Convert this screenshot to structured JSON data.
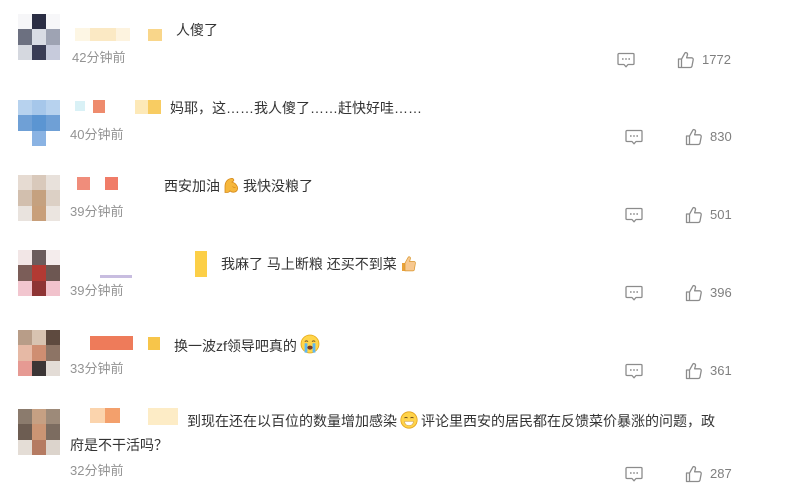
{
  "colors": {
    "background": "#ffffff",
    "text": "#333333",
    "meta_text": "#939393",
    "icon": "#8c8c8c",
    "like_count": "#7f7f7f"
  },
  "icons": {
    "reply": "comment-icon",
    "like": "like-icon"
  },
  "comments": [
    {
      "text": "人傻了",
      "time": "42分钟前",
      "likes": "1772",
      "avatar_mosaic": [
        "#f6f6f8",
        "#2b2e44",
        "#f7f7f9",
        "#6c7080",
        "#d9dce4",
        "#9ea3b3",
        "#d5d8df",
        "#3a3d55",
        "#c7cbdc"
      ]
    },
    {
      "text": "妈耶，这……我人傻了……赶快好哇……",
      "time": "40分钟前",
      "likes": "830",
      "avatar_mosaic": [
        "#b7d2ee",
        "#a6c7ea",
        "#b7d2ee",
        "#6fa0d6",
        "#5b95d2",
        "#6fa0d6",
        "#ffffff",
        "#8ab3e3",
        "#ffffff"
      ]
    },
    {
      "text": "西安加油",
      "emoji": "flexed-biceps-emoji",
      "text_after_emoji": "我快没粮了",
      "time": "39分钟前",
      "likes": "501",
      "avatar_mosaic": [
        "#e6dbd2",
        "#d9c9bb",
        "#e8e1db",
        "#d2bfae",
        "#c5a17f",
        "#dcd0c5",
        "#e9e3de",
        "#c89f7a",
        "#ebe5e0"
      ]
    },
    {
      "text": "我麻了 马上断粮 还买不到菜",
      "emoji": "thumbs-up-emoji",
      "time": "39分钟前",
      "likes": "396",
      "avatar_mosaic": [
        "#f2e6e6",
        "#6b5c5c",
        "#f4ecec",
        "#7b5d58",
        "#b23a33",
        "#6d5752",
        "#f2c6cf",
        "#8e3434",
        "#f1c2cc"
      ]
    },
    {
      "text": "换一波zf领导吧真的",
      "emoji": "crying-face-emoji",
      "time": "33分钟前",
      "likes": "361",
      "avatar_mosaic": [
        "#b89d88",
        "#d8c3b1",
        "#5e4a3f",
        "#e6b9a5",
        "#cf8e72",
        "#8d7465",
        "#e69a93",
        "#3b3535",
        "#e3dcd6"
      ]
    },
    {
      "text": "到现在还在以百位的数量增加感染",
      "emoji": "face-emoji",
      "text_after_emoji": "评论里西安的居民都在反馈菜价暴涨的问题，政",
      "text_continued": "府是不干活吗？",
      "time": "32分钟前",
      "likes": "287",
      "avatar_mosaic": [
        "#8b7b6d",
        "#c6a083",
        "#9d8a79",
        "#6d5d52",
        "#cb9574",
        "#7c6c60",
        "#e4ddd6",
        "#b57b62",
        "#dcd4cc"
      ]
    }
  ]
}
